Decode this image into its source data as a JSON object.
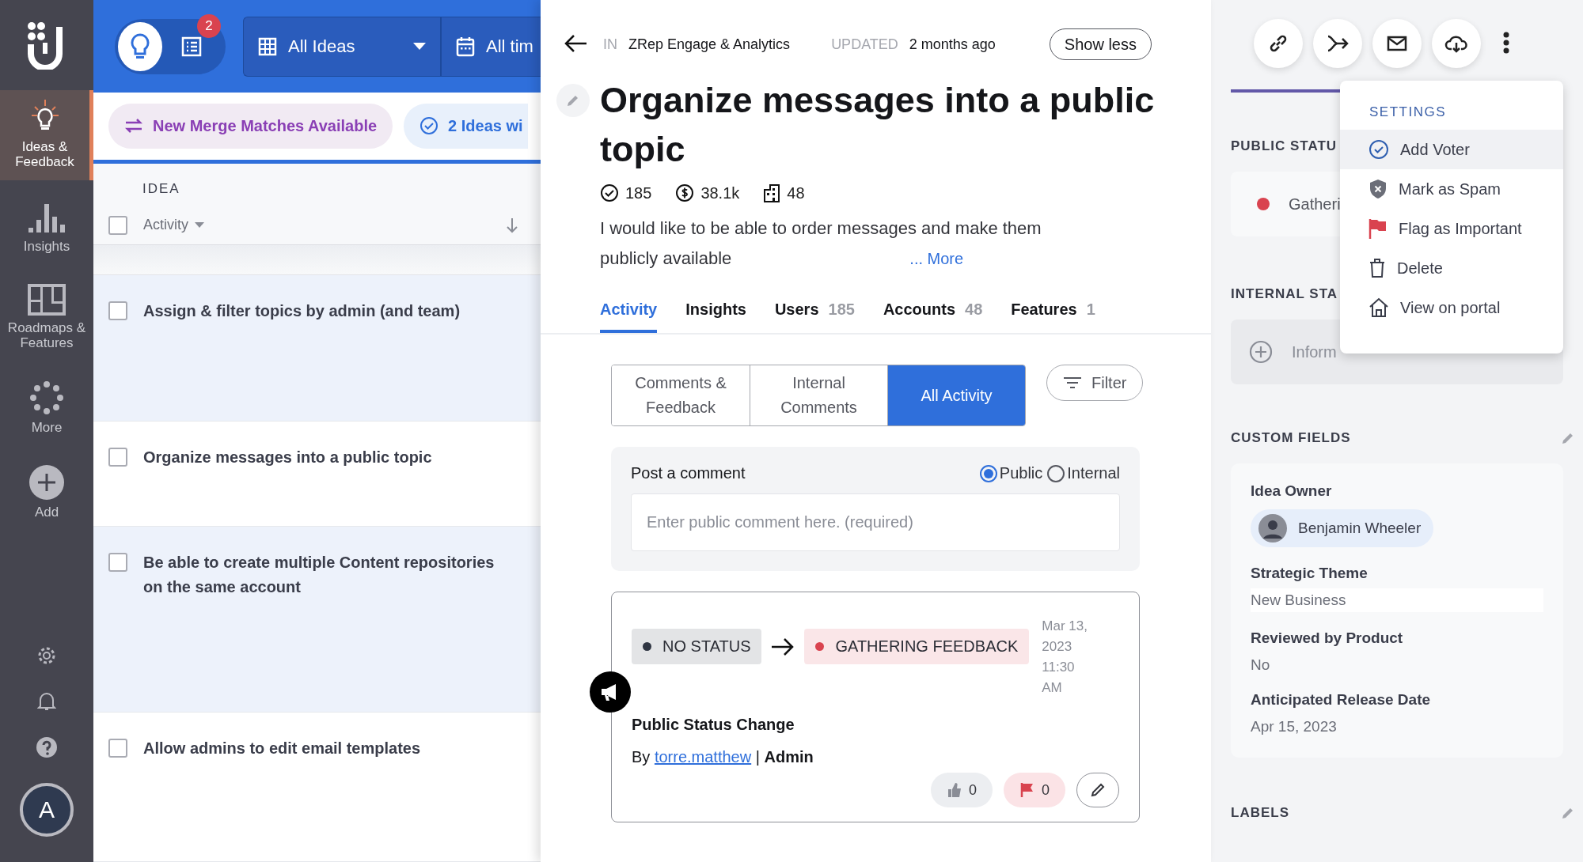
{
  "nav": {
    "items": [
      {
        "label": "Ideas & Feedback",
        "selected": true
      },
      {
        "label": "Insights",
        "selected": false
      },
      {
        "label": "Roadmaps & Features",
        "selected": false
      },
      {
        "label": "More",
        "selected": false
      },
      {
        "label": "Add",
        "selected": false
      }
    ],
    "avatar": "A"
  },
  "toolbar": {
    "view_toggle": [
      {
        "selected": true
      },
      {
        "selected": false
      }
    ],
    "badge": "2",
    "view_filter": "All Ideas",
    "time_filter": "All tim"
  },
  "banners": [
    {
      "text": "New Merge Matches Available",
      "kind": "merge"
    },
    {
      "text": "2 Ideas wi",
      "kind": "check"
    }
  ],
  "list": {
    "heading": "IDEA",
    "sort": "Activity",
    "select_all_checked": false,
    "rows": [
      {
        "title": "Assign & filter topics by admin (and team)",
        "checked": false,
        "highlighted": true
      },
      {
        "title": "Organize messages into a public topic",
        "checked": false,
        "highlighted": false
      },
      {
        "title": "Be able to create multiple Content repositories on the same account",
        "checked": false,
        "highlighted": true
      },
      {
        "title": "Allow admins to edit email templates",
        "checked": false,
        "highlighted": false
      }
    ]
  },
  "detail": {
    "in_label": "IN",
    "project": "ZRep Engage & Analytics",
    "updated_label": "UPDATED",
    "updated": "2 months ago",
    "toggle_button": "Show less",
    "title": "Organize messages into a public topic",
    "stats": [
      "185",
      "38.1k",
      "48"
    ],
    "description": "I would like to be able to order messages and make them publicly available",
    "more_link": "... More",
    "tabs": [
      {
        "label": "Activity",
        "selected": true
      },
      {
        "label": "Insights",
        "selected": false
      },
      {
        "label": "Users",
        "count": "185",
        "selected": false
      },
      {
        "label": "Accounts",
        "count": "48",
        "selected": false
      },
      {
        "label": "Features",
        "count": "1",
        "selected": false
      }
    ],
    "segments": [
      {
        "label": "Comments & Feedback",
        "selected": false
      },
      {
        "label": "Internal Comments",
        "selected": false
      },
      {
        "label": "All Activity",
        "selected": true
      }
    ],
    "filter_button": "Filter",
    "comment_form": {
      "label": "Post a comment",
      "visibility": [
        {
          "label": "Public",
          "selected": true
        },
        {
          "label": "Internal",
          "selected": false
        }
      ],
      "placeholder": "Enter public comment here. (required)"
    },
    "activity": [
      {
        "statuses": [
          {
            "label": "NO STATUS",
            "color": "#2f3542"
          },
          {
            "label": "GATHERING FEEDBACK",
            "color": "#d9434f"
          }
        ],
        "timestamp": "Mar 13, 2023 11:30 AM",
        "title": "Public Status Change",
        "by_label": "By",
        "author": "torre.matthew",
        "separator": "|",
        "role": "Admin",
        "upvotes": "0",
        "downvotes": "0"
      }
    ]
  },
  "actions_menu": {
    "heading": "SETTINGS",
    "items": [
      {
        "label": "Add Voter",
        "selected": true
      },
      {
        "label": "Mark as Spam",
        "selected": false
      },
      {
        "label": "Flag as Important",
        "selected": false
      },
      {
        "label": "Delete",
        "selected": false
      },
      {
        "label": "View on portal",
        "selected": false
      }
    ]
  },
  "side": {
    "public_status": {
      "heading": "PUBLIC STATU",
      "value": "Gatheri",
      "color": "#d9434f"
    },
    "internal_status": {
      "heading": "INTERNAL STA",
      "value": "Inform"
    },
    "custom_fields": {
      "heading": "CUSTOM FIELDS",
      "fields": [
        {
          "label": "Idea Owner",
          "value": "Benjamin Wheeler",
          "kind": "person"
        },
        {
          "label": "Strategic Theme",
          "value": "New Business",
          "kind": "input"
        },
        {
          "label": "Reviewed by Product",
          "value": "No",
          "kind": "text"
        },
        {
          "label": "Anticipated Release Date",
          "value": "Apr 15, 2023",
          "kind": "text"
        }
      ]
    },
    "labels_heading": "LABELS"
  }
}
